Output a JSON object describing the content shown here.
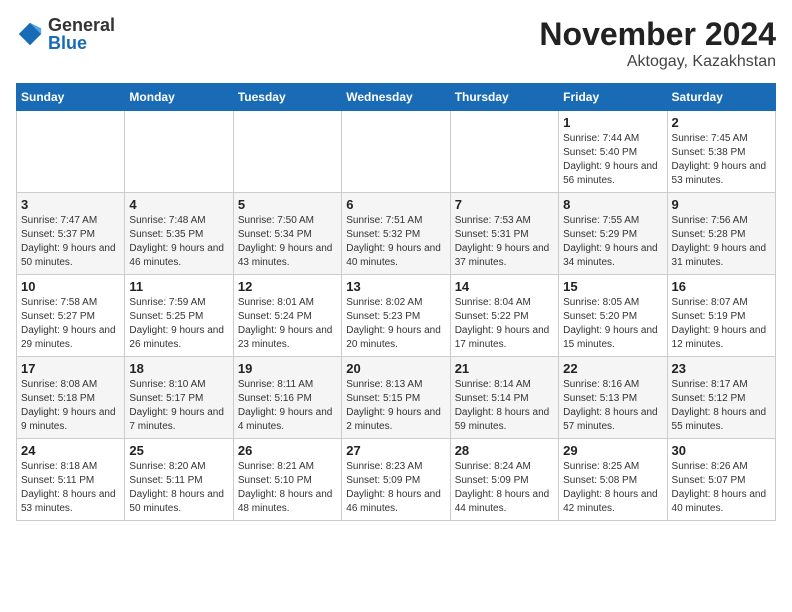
{
  "logo": {
    "general": "General",
    "blue": "Blue"
  },
  "title": "November 2024",
  "subtitle": "Aktogay, Kazakhstan",
  "headers": [
    "Sunday",
    "Monday",
    "Tuesday",
    "Wednesday",
    "Thursday",
    "Friday",
    "Saturday"
  ],
  "weeks": [
    [
      {
        "day": "",
        "info": ""
      },
      {
        "day": "",
        "info": ""
      },
      {
        "day": "",
        "info": ""
      },
      {
        "day": "",
        "info": ""
      },
      {
        "day": "",
        "info": ""
      },
      {
        "day": "1",
        "info": "Sunrise: 7:44 AM\nSunset: 5:40 PM\nDaylight: 9 hours and 56 minutes."
      },
      {
        "day": "2",
        "info": "Sunrise: 7:45 AM\nSunset: 5:38 PM\nDaylight: 9 hours and 53 minutes."
      }
    ],
    [
      {
        "day": "3",
        "info": "Sunrise: 7:47 AM\nSunset: 5:37 PM\nDaylight: 9 hours and 50 minutes."
      },
      {
        "day": "4",
        "info": "Sunrise: 7:48 AM\nSunset: 5:35 PM\nDaylight: 9 hours and 46 minutes."
      },
      {
        "day": "5",
        "info": "Sunrise: 7:50 AM\nSunset: 5:34 PM\nDaylight: 9 hours and 43 minutes."
      },
      {
        "day": "6",
        "info": "Sunrise: 7:51 AM\nSunset: 5:32 PM\nDaylight: 9 hours and 40 minutes."
      },
      {
        "day": "7",
        "info": "Sunrise: 7:53 AM\nSunset: 5:31 PM\nDaylight: 9 hours and 37 minutes."
      },
      {
        "day": "8",
        "info": "Sunrise: 7:55 AM\nSunset: 5:29 PM\nDaylight: 9 hours and 34 minutes."
      },
      {
        "day": "9",
        "info": "Sunrise: 7:56 AM\nSunset: 5:28 PM\nDaylight: 9 hours and 31 minutes."
      }
    ],
    [
      {
        "day": "10",
        "info": "Sunrise: 7:58 AM\nSunset: 5:27 PM\nDaylight: 9 hours and 29 minutes."
      },
      {
        "day": "11",
        "info": "Sunrise: 7:59 AM\nSunset: 5:25 PM\nDaylight: 9 hours and 26 minutes."
      },
      {
        "day": "12",
        "info": "Sunrise: 8:01 AM\nSunset: 5:24 PM\nDaylight: 9 hours and 23 minutes."
      },
      {
        "day": "13",
        "info": "Sunrise: 8:02 AM\nSunset: 5:23 PM\nDaylight: 9 hours and 20 minutes."
      },
      {
        "day": "14",
        "info": "Sunrise: 8:04 AM\nSunset: 5:22 PM\nDaylight: 9 hours and 17 minutes."
      },
      {
        "day": "15",
        "info": "Sunrise: 8:05 AM\nSunset: 5:20 PM\nDaylight: 9 hours and 15 minutes."
      },
      {
        "day": "16",
        "info": "Sunrise: 8:07 AM\nSunset: 5:19 PM\nDaylight: 9 hours and 12 minutes."
      }
    ],
    [
      {
        "day": "17",
        "info": "Sunrise: 8:08 AM\nSunset: 5:18 PM\nDaylight: 9 hours and 9 minutes."
      },
      {
        "day": "18",
        "info": "Sunrise: 8:10 AM\nSunset: 5:17 PM\nDaylight: 9 hours and 7 minutes."
      },
      {
        "day": "19",
        "info": "Sunrise: 8:11 AM\nSunset: 5:16 PM\nDaylight: 9 hours and 4 minutes."
      },
      {
        "day": "20",
        "info": "Sunrise: 8:13 AM\nSunset: 5:15 PM\nDaylight: 9 hours and 2 minutes."
      },
      {
        "day": "21",
        "info": "Sunrise: 8:14 AM\nSunset: 5:14 PM\nDaylight: 8 hours and 59 minutes."
      },
      {
        "day": "22",
        "info": "Sunrise: 8:16 AM\nSunset: 5:13 PM\nDaylight: 8 hours and 57 minutes."
      },
      {
        "day": "23",
        "info": "Sunrise: 8:17 AM\nSunset: 5:12 PM\nDaylight: 8 hours and 55 minutes."
      }
    ],
    [
      {
        "day": "24",
        "info": "Sunrise: 8:18 AM\nSunset: 5:11 PM\nDaylight: 8 hours and 53 minutes."
      },
      {
        "day": "25",
        "info": "Sunrise: 8:20 AM\nSunset: 5:11 PM\nDaylight: 8 hours and 50 minutes."
      },
      {
        "day": "26",
        "info": "Sunrise: 8:21 AM\nSunset: 5:10 PM\nDaylight: 8 hours and 48 minutes."
      },
      {
        "day": "27",
        "info": "Sunrise: 8:23 AM\nSunset: 5:09 PM\nDaylight: 8 hours and 46 minutes."
      },
      {
        "day": "28",
        "info": "Sunrise: 8:24 AM\nSunset: 5:09 PM\nDaylight: 8 hours and 44 minutes."
      },
      {
        "day": "29",
        "info": "Sunrise: 8:25 AM\nSunset: 5:08 PM\nDaylight: 8 hours and 42 minutes."
      },
      {
        "day": "30",
        "info": "Sunrise: 8:26 AM\nSunset: 5:07 PM\nDaylight: 8 hours and 40 minutes."
      }
    ]
  ]
}
